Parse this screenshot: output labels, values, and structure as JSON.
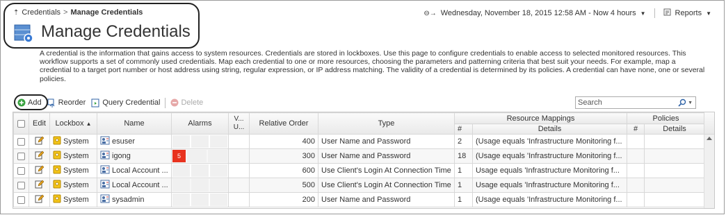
{
  "breadcrumb": {
    "parent": "Credentials",
    "current": "Manage Credentials"
  },
  "topbar": {
    "datetime": "Wednesday, November 18, 2015 12:58 AM - Now 4 hours",
    "reports_label": "Reports"
  },
  "page": {
    "title": "Manage Credentials",
    "description": "A credential is the information that gains access to system resources. Credentials are stored in lockboxes. Use this page to configure credentials to enable access to selected monitored resources. This workflow supports a set of commonly used credentials. Map each credential to one or more resources, choosing the parameters and patterning criteria that best suit your needs. For example, map a credential to a target port number or host address using string, regular expression, or IP address matching. The validity of a credential is determined by its policies. A credential can have none, one or several policies."
  },
  "toolbar": {
    "add": "Add",
    "reorder": "Reorder",
    "query": "Query Credential",
    "delete": "Delete",
    "search_placeholder": "Search"
  },
  "grid": {
    "headers": {
      "edit": "Edit",
      "lockbox": "Lockbox",
      "name": "Name",
      "alarms": "Alarms",
      "vu": "V... U...",
      "relative_order": "Relative Order",
      "type": "Type",
      "resource_mappings": "Resource Mappings",
      "rm_count": "#",
      "rm_details": "Details",
      "policies": "Policies",
      "pol_count": "#",
      "pol_details": "Details"
    },
    "rows": [
      {
        "lockbox": "System",
        "name": "esuser",
        "alarm": "",
        "order": "400",
        "type": "User Name and Password",
        "rm_count": "2",
        "rm_details": "(Usage equals 'Infrastructure Monitoring f..."
      },
      {
        "lockbox": "System",
        "name": "igong",
        "alarm": "5",
        "order": "300",
        "type": "User Name and Password",
        "rm_count": "18",
        "rm_details": "(Usage equals 'Infrastructure Monitoring f..."
      },
      {
        "lockbox": "System",
        "name": "Local Account ...",
        "alarm": "",
        "order": "600",
        "type": "Use Client's Login At Connection Time",
        "rm_count": "1",
        "rm_details": "Usage equals 'Infrastructure Monitoring f..."
      },
      {
        "lockbox": "System",
        "name": "Local Account ...",
        "alarm": "",
        "order": "500",
        "type": "Use Client's Login At Connection Time",
        "rm_count": "1",
        "rm_details": "Usage equals 'Infrastructure Monitoring f..."
      },
      {
        "lockbox": "System",
        "name": "sysadmin",
        "alarm": "",
        "order": "200",
        "type": "User Name and Password",
        "rm_count": "1",
        "rm_details": "(Usage equals 'Infrastructure Monitoring f..."
      }
    ]
  },
  "colors": {
    "alarm_critical": "#e8321e",
    "add_green": "#3aa341",
    "lockbox_yellow": "#f3c419"
  }
}
